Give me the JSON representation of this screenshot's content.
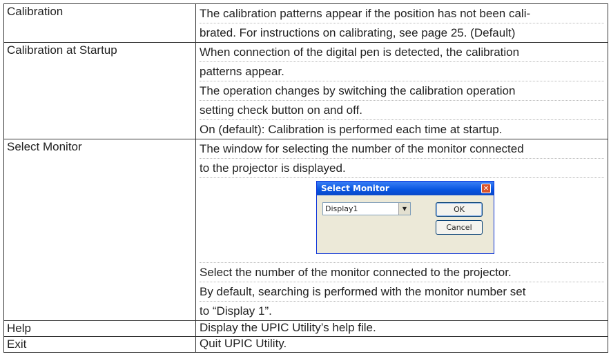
{
  "rows": [
    {
      "term": "Calibration",
      "lines": [
        "The calibration patterns appear if the position has not been cali-",
        "brated. For instructions on calibrating, see page 25. (Default)"
      ]
    },
    {
      "term": "Calibration at Startup",
      "lines": [
        "When connection of the digital pen is detected, the calibration",
        "patterns appear.",
        "The operation changes by switching the calibration operation",
        "setting check button on and off.",
        "On (default): Calibration is performed each time at startup."
      ]
    },
    {
      "term": "Select Monitor",
      "lines_before": [
        "The window for selecting the number of the monitor connected",
        "to the projector is displayed."
      ],
      "dialog": {
        "title": "Select Monitor",
        "close_glyph": "✕",
        "select_value": "Display1",
        "dropdown_glyph": "▼",
        "ok_label": "OK",
        "cancel_label": "Cancel"
      },
      "lines_after": [
        "Select the number of the monitor connected to the projector.",
        "By default, searching is performed with the monitor number set",
        "to “Display 1”."
      ]
    },
    {
      "term": "Help",
      "lines": [
        "Display the UPIC Utility’s help file."
      ]
    },
    {
      "term": "Exit",
      "lines": [
        "Quit UPIC Utility."
      ]
    }
  ]
}
